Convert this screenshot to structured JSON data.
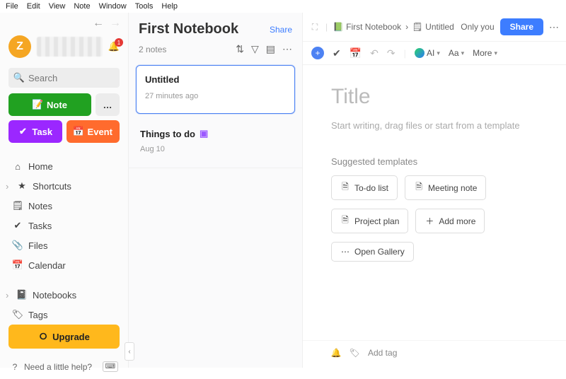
{
  "menubar": [
    "File",
    "Edit",
    "View",
    "Note",
    "Window",
    "Tools",
    "Help"
  ],
  "user": {
    "initial": "Z",
    "badge": "1"
  },
  "search": {
    "placeholder": "Search"
  },
  "buttons": {
    "note": "Note",
    "task": "Task",
    "event": "Event",
    "upgrade": "Upgrade"
  },
  "nav": {
    "home": "Home",
    "shortcuts": "Shortcuts",
    "notes": "Notes",
    "tasks": "Tasks",
    "files": "Files",
    "calendar": "Calendar",
    "notebooks": "Notebooks",
    "tags": "Tags"
  },
  "help": "Need a little help?",
  "notelist": {
    "title": "First Notebook",
    "share": "Share",
    "count": "2 notes",
    "notes": [
      {
        "title": "Untitled",
        "time": "27 minutes ago"
      },
      {
        "title": "Things to do",
        "time": "Aug 10"
      }
    ]
  },
  "editor": {
    "crumb_notebook": "First Notebook",
    "crumb_note": "Untitled",
    "visibility": "Only you",
    "share": "Share",
    "ai": "AI",
    "font": "Aa",
    "more": "More",
    "title_placeholder": "Title",
    "body_placeholder": "Start writing, drag files or start from a template",
    "suggested_heading": "Suggested templates",
    "templates": [
      "To-do list",
      "Meeting note",
      "Project plan",
      "Add more",
      "Open Gallery"
    ],
    "addtag": "Add tag"
  }
}
